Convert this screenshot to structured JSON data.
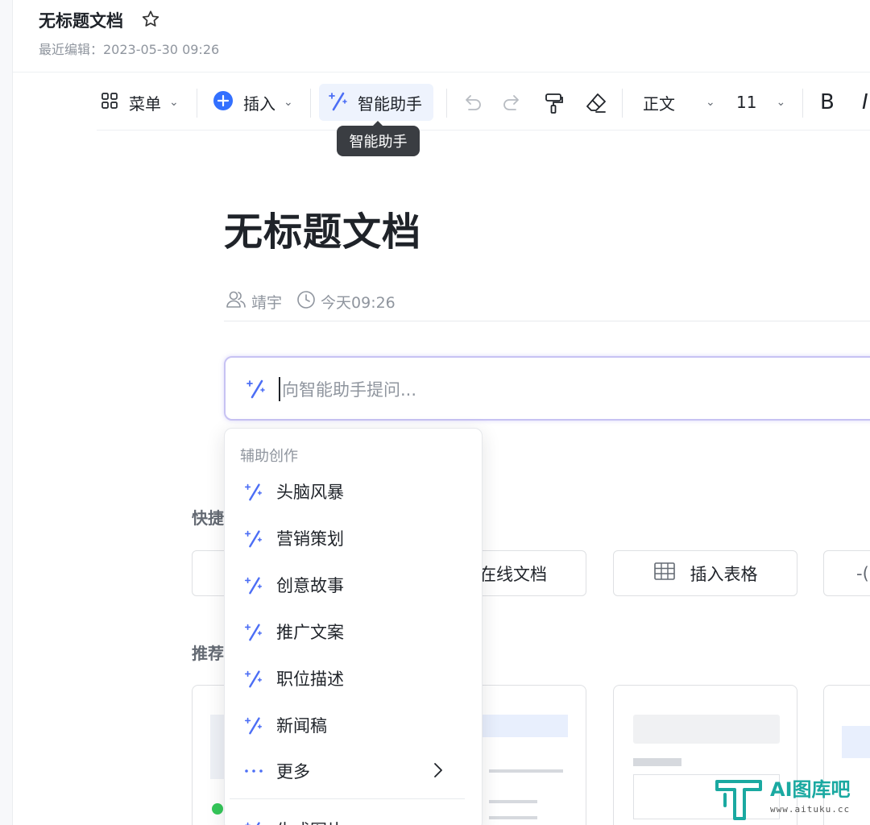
{
  "header": {
    "title": "无标题文档",
    "last_edit": "最近编辑：2023-05-30 09:26"
  },
  "toolbar": {
    "menu_label": "菜单",
    "insert_label": "插入",
    "ai_label": "智能助手",
    "style_label": "正文",
    "font_size": "11",
    "bold_label": "B"
  },
  "tooltip": {
    "text": "智能助手"
  },
  "document": {
    "title": "无标题文档",
    "author": "靖宇",
    "time": "今天09:26"
  },
  "ai_input": {
    "placeholder": "向智能助手提问..."
  },
  "quick": {
    "label_partial": "快捷",
    "cards": [
      "在线文档",
      "插入表格"
    ]
  },
  "recommend": {
    "label_partial": "推荐"
  },
  "dropdown": {
    "group_label": "辅助创作",
    "items": [
      "头脑风暴",
      "营销策划",
      "创意故事",
      "推广文案",
      "职位描述",
      "新闻稿"
    ],
    "more_label": "更多",
    "partial_item": "生成图片"
  },
  "watermark": {
    "brand": "AI图库吧",
    "url": "www.aituku.cc"
  },
  "colors": {
    "accent": "#3370ff",
    "ai_blue": "#4c6ef5",
    "tooltip_bg": "#3a3d42"
  }
}
